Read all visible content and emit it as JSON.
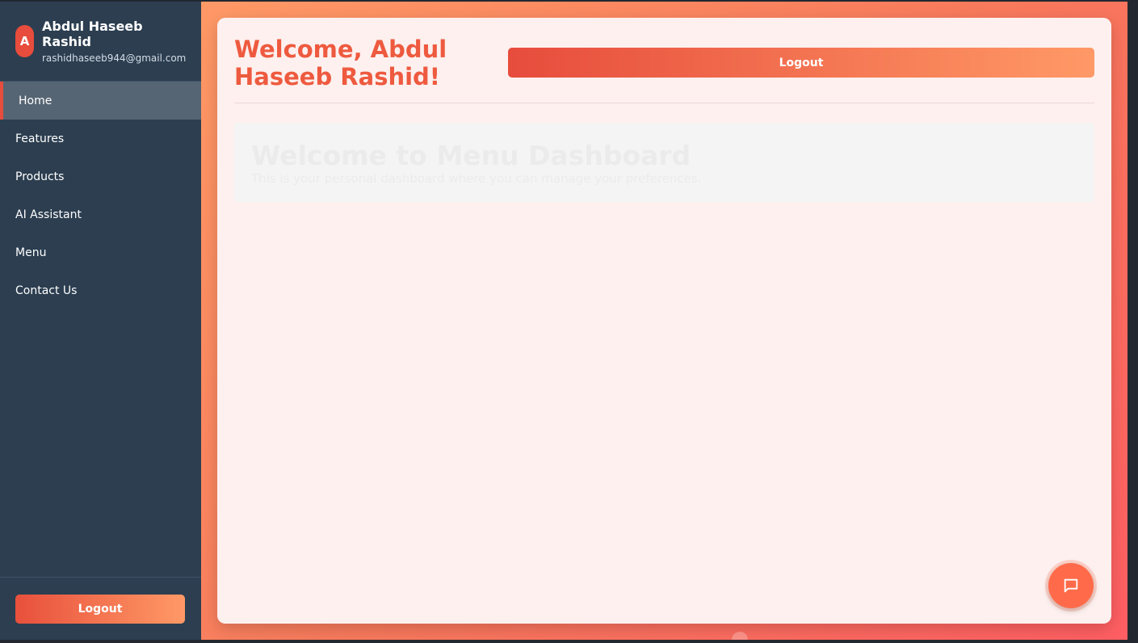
{
  "user": {
    "initial": "A",
    "name": "Abdul Haseeb Rashid",
    "email": "rashidhaseeb944@gmail.com"
  },
  "sidebar": {
    "items": [
      {
        "label": "Home",
        "active": true
      },
      {
        "label": "Features"
      },
      {
        "label": "Products"
      },
      {
        "label": "AI Assistant"
      },
      {
        "label": "Menu"
      },
      {
        "label": "Contact Us"
      }
    ],
    "logout_label": "Logout"
  },
  "header": {
    "welcome_line1": "Welcome, Abdul",
    "welcome_line2": "Haseeb Rashid!",
    "logout_label": "Logout"
  },
  "dashboard": {
    "title": "Welcome to Menu Dashboard",
    "subtitle": "This is your personal dashboard where you can manage your preferences."
  },
  "chat": {
    "icon": "chat-bubble-icon"
  },
  "colors": {
    "sidebar_bg": "#2c3e50",
    "accent": "#e74c3c",
    "accent_light": "#ff9966"
  }
}
